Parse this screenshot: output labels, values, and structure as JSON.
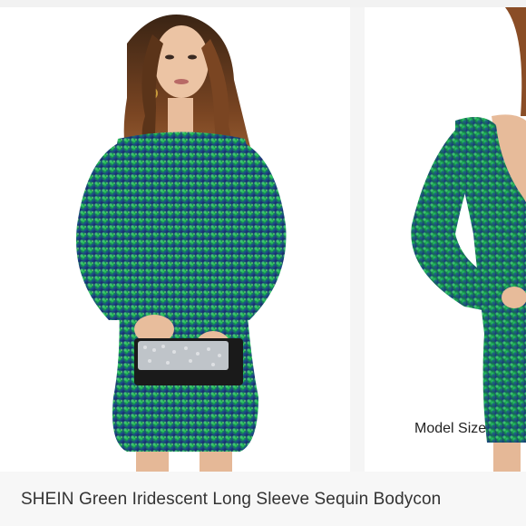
{
  "listing": {
    "caption": "SHEIN  Green Iridescent Long Sleeve Sequin Bodycon"
  },
  "gallery": {
    "images": [
      {
        "view": "front",
        "overlay_text": ""
      },
      {
        "view": "back",
        "overlay_text": "Model Size"
      }
    ]
  },
  "colors": {
    "dress_green": "#1c8a3e",
    "dress_blue": "#1f3f86",
    "dress_teal": "#1aa38a",
    "hair": "#6b3a1e",
    "skin": "#e9bf9e",
    "clutch": "#1a1a1a"
  }
}
